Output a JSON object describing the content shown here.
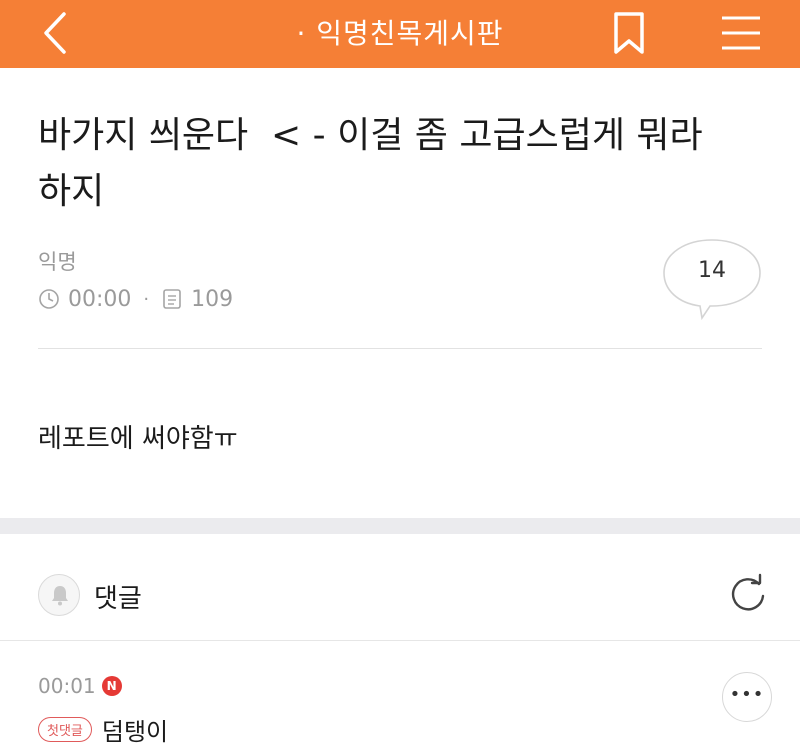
{
  "topbar": {
    "title": "· 익명친목게시판",
    "back_icon": "chevron-left-icon",
    "bookmark_icon": "bookmark-icon",
    "menu_icon": "hamburger-menu-icon",
    "background_color": "#f57f36"
  },
  "post": {
    "title": "바가지 씌운다  < - 이걸 좀 고급스럽게 뭐라\n하지",
    "author": "익명",
    "time": "00:00",
    "views": "109",
    "comment_count": "14",
    "body": "레포트에 써야함ㅠ"
  },
  "comments": {
    "header_label": "댓글",
    "items": [
      {
        "time": "00:01",
        "new_badge": "N",
        "first_badge": "첫댓글",
        "text": "덤탱이"
      }
    ]
  }
}
